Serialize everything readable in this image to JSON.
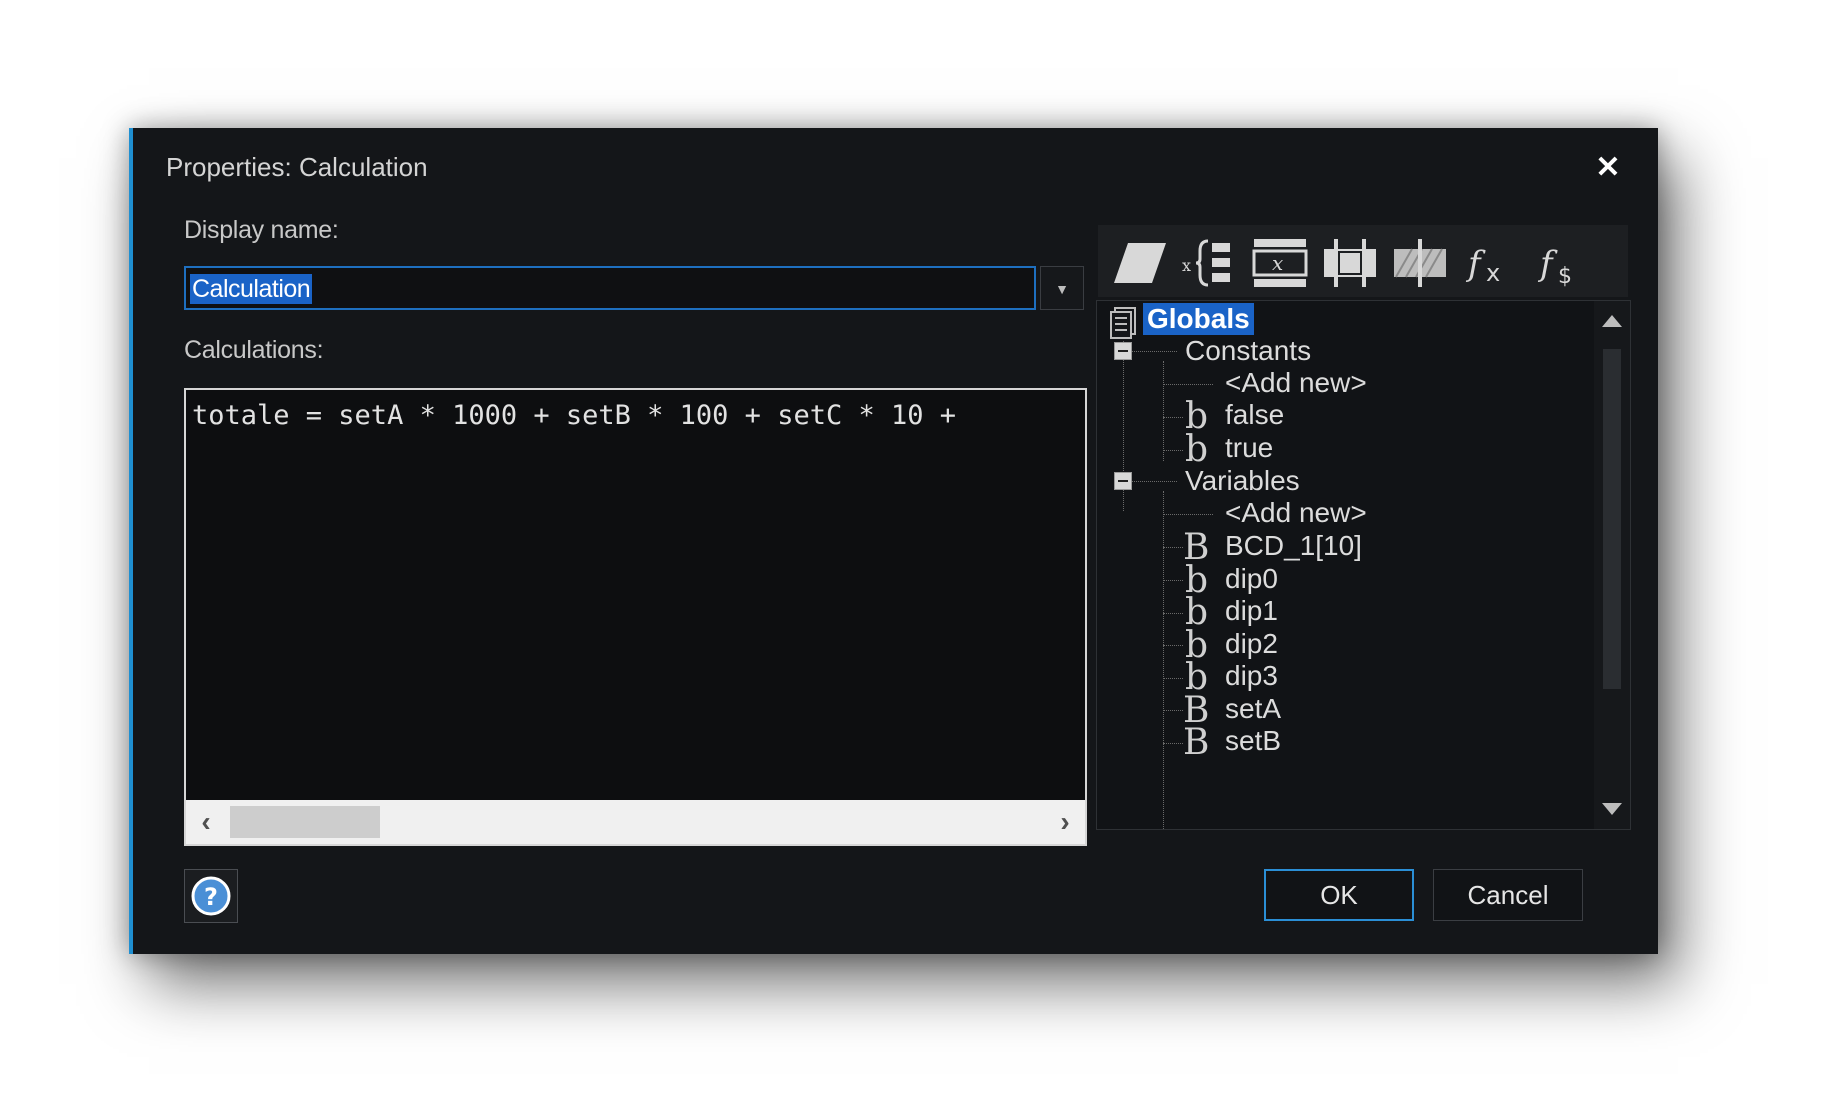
{
  "dialog": {
    "title": "Properties: Calculation",
    "close_label": "✕"
  },
  "display_name": {
    "label": "Display name:",
    "value": "Calculation"
  },
  "calculations": {
    "label": "Calculations:",
    "text": "totale = setA * 1000 + setB * 100 + setC * 10 +"
  },
  "toolbar": {
    "icons": [
      "parallelogram-icon",
      "variable-bracket-icon",
      "x-box-icon",
      "split-box-icon",
      "hatched-box-icon",
      "fx-icon",
      "fs-icon"
    ]
  },
  "tree": {
    "root": "Globals",
    "constants": {
      "label": "Constants",
      "items": [
        {
          "icon": "",
          "label": "<Add new>"
        },
        {
          "icon": "b",
          "label": "false"
        },
        {
          "icon": "b",
          "label": "true"
        }
      ]
    },
    "variables": {
      "label": "Variables",
      "items": [
        {
          "icon": "",
          "label": "<Add new>"
        },
        {
          "icon": "B",
          "label": "BCD_1[10]"
        },
        {
          "icon": "b",
          "label": "dip0"
        },
        {
          "icon": "b",
          "label": "dip1"
        },
        {
          "icon": "b",
          "label": "dip2"
        },
        {
          "icon": "b",
          "label": "dip3"
        },
        {
          "icon": "B",
          "label": "setA"
        },
        {
          "icon": "B",
          "label": "setB"
        }
      ]
    }
  },
  "buttons": {
    "ok": "OK",
    "cancel": "Cancel"
  },
  "colors": {
    "background": "#141619",
    "accent": "#1f8fd1",
    "selection": "#1a63c7"
  }
}
